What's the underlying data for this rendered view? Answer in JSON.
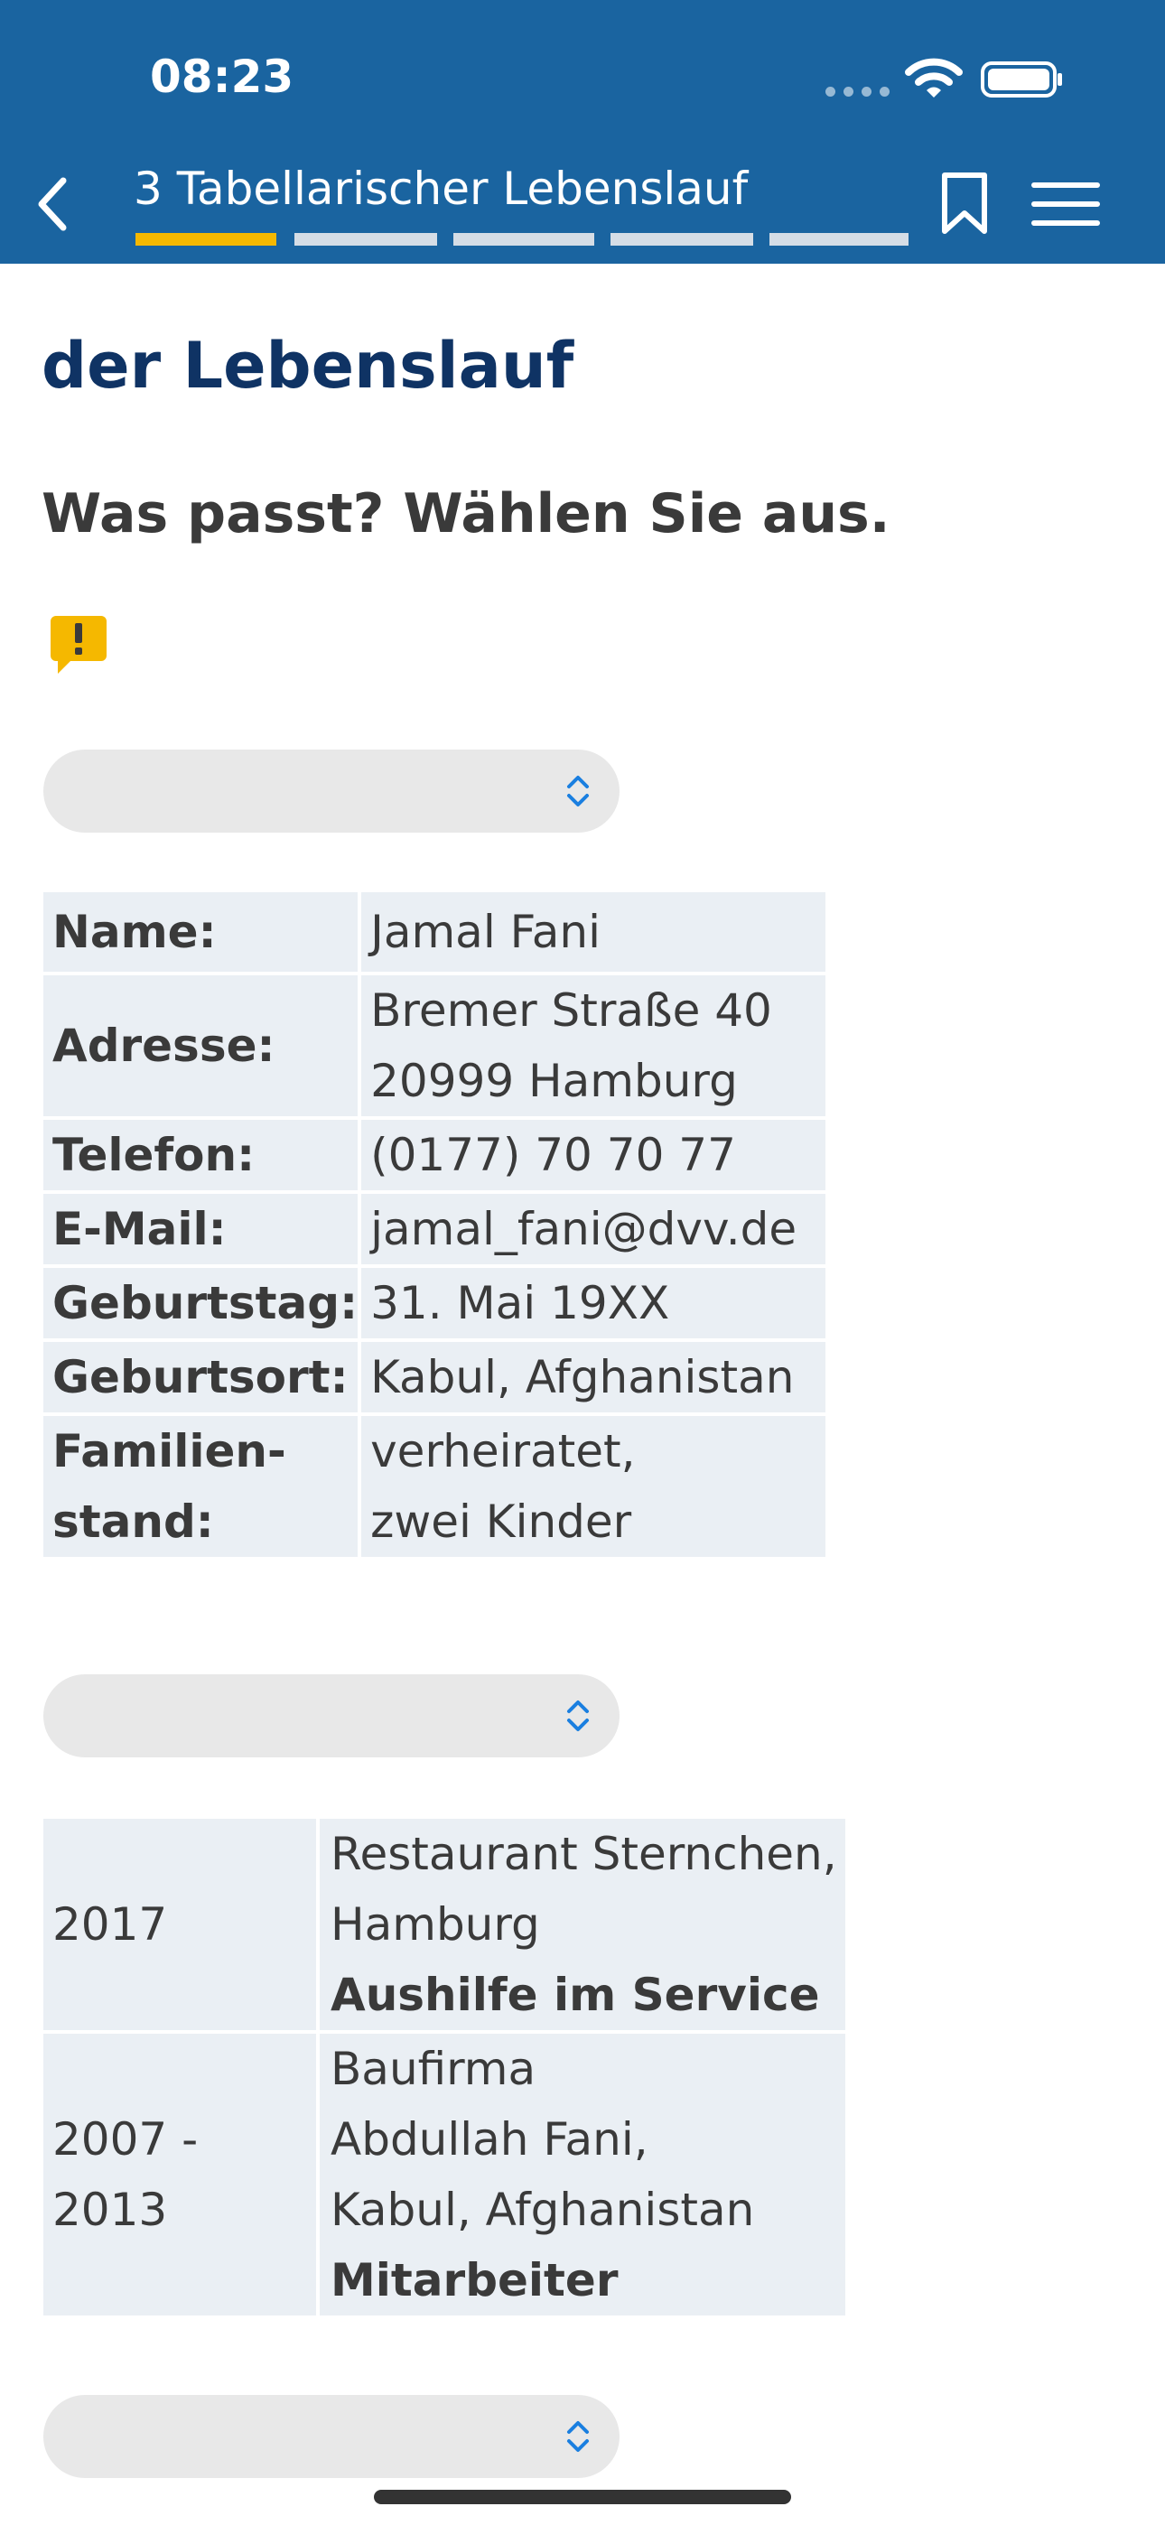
{
  "status_bar": {
    "time": "08:23"
  },
  "nav": {
    "title": "3 Tabellarischer Lebenslauf",
    "progress": {
      "total_segments": 5,
      "active_segment": 1
    },
    "icons": {
      "back": "chevron-left-icon",
      "bookmark": "bookmark-icon",
      "menu": "hamburger-menu-icon"
    }
  },
  "content": {
    "title": "der Lebenslauf",
    "instruction": "Was passt? Wählen Sie aus.",
    "hint_icon": "exclamation-speech-bubble-icon",
    "selects": [
      {
        "value": ""
      },
      {
        "value": ""
      },
      {
        "value": ""
      }
    ],
    "personal_table": [
      {
        "label": "Name:",
        "lines": [
          "Jamal Fani"
        ]
      },
      {
        "label": "Adresse:",
        "lines": [
          "Bremer Straße 40",
          "20999 Hamburg"
        ]
      },
      {
        "label": "Telefon:",
        "lines": [
          "(0177) 70 70 77"
        ]
      },
      {
        "label": "E-Mail:",
        "lines": [
          "jamal_fani@dvv.de"
        ]
      },
      {
        "label": "Geburtstag:",
        "lines": [
          "31. Mai 19XX"
        ]
      },
      {
        "label": "Geburtsort:",
        "lines": [
          "Kabul, Afghanistan"
        ]
      },
      {
        "label_lines": [
          "Familien-",
          "stand:"
        ],
        "lines": [
          "verheiratet,",
          "zwei Kinder"
        ]
      }
    ],
    "experience_table": [
      {
        "period": "2017",
        "lines": [
          "Restaurant Sternchen,",
          "Hamburg"
        ],
        "role": "Aushilfe im Service"
      },
      {
        "period": "2007 - 2013",
        "lines": [
          "Baufirma",
          "Abdullah Fani,",
          "Kabul, Afghanistan"
        ],
        "role": "Mitarbeiter"
      }
    ]
  },
  "colors": {
    "header_bg": "#1a64a0",
    "title": "#0f3364",
    "progress_active": "#f5b800",
    "progress_inactive": "#d5dde6",
    "table_cell": "#eaeff4",
    "select_bg": "#e8e8e8",
    "select_chevron": "#1a7fe0",
    "hint_icon": "#f5b800"
  }
}
